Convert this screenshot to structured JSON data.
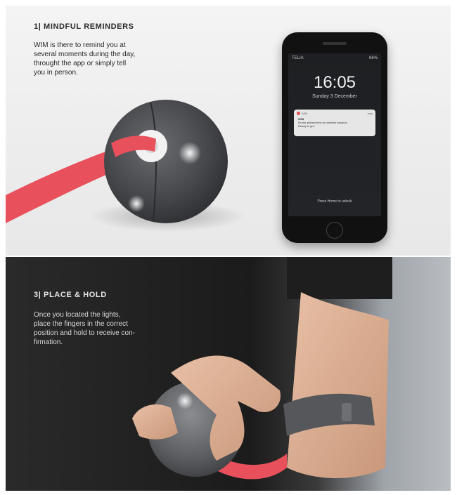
{
  "top": {
    "heading": "1| MINDFUL REMINDERS",
    "body": "WIM is there to remind you at\nseveral moments during the day,\nthrought the app or simply tell\nyou in person."
  },
  "phone": {
    "carrier": "TELIA",
    "battery": "86%",
    "time": "16:05",
    "date": "Sunday 3 December",
    "notification": {
      "app": "WIM",
      "when": "now",
      "title": "WIM",
      "text": "It's the perfect time for another session!\nReady to go?"
    },
    "unlock": "Press Home to unlock"
  },
  "bottom": {
    "heading": "3| PLACE & HOLD",
    "body": "Once you located the lights,\nplace the fingers in the correct\nposition and hold to receive con-\nfirmation."
  },
  "colors": {
    "strap": "#e8505b",
    "device": "#4a4c50",
    "light": "#ffffff"
  }
}
